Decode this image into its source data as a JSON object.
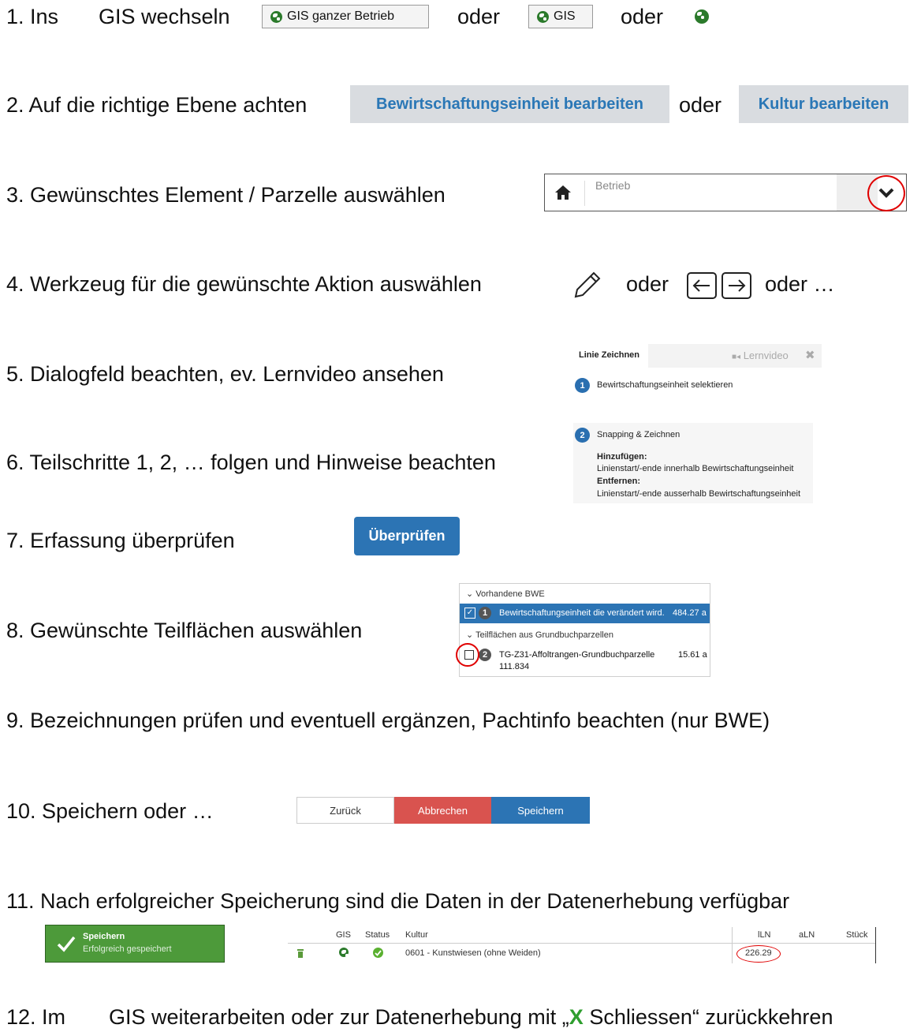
{
  "steps": {
    "s1": {
      "num": "1. Ins",
      "text": "GIS wechseln",
      "btn_full": "GIS ganzer Betrieb",
      "or1": "oder",
      "btn_gis": "GIS",
      "or2": "oder"
    },
    "s2": {
      "text": "2. Auf die richtige Ebene achten",
      "tab1": "Bewirtschaftungseinheit bearbeiten",
      "or": "oder",
      "tab2": "Kultur bearbeiten"
    },
    "s3": {
      "text": "3. Gewünschtes Element / Parzelle auswählen",
      "select_label": "Betrieb"
    },
    "s4": {
      "text": "4. Werkzeug für die gewünschte Aktion auswählen",
      "or1": "oder",
      "or2": "oder …"
    },
    "s5": {
      "text": "5. Dialogfeld beachten, ev. Lernvideo ansehen"
    },
    "s6": {
      "text": "6. Teilschritte 1, 2, … folgen und Hinweise beachten"
    },
    "s7": {
      "text": "7. Erfassung überprüfen",
      "button": "Überprüfen"
    },
    "s8": {
      "text": "8. Gewünschte Teilflächen auswählen"
    },
    "s9": {
      "text": "9. Bezeichnungen prüfen und eventuell ergänzen, Pachtinfo beachten (nur BWE)"
    },
    "s10": {
      "text": "10. Speichern oder …",
      "back": "Zurück",
      "cancel": "Abbrechen",
      "save": "Speichern"
    },
    "s11": {
      "text": "11. Nach erfolgreicher Speicherung sind die Daten in der Datenerhebung verfügbar"
    },
    "s12": {
      "num": "12. Im",
      "pre": "GIS weiterarbeiten oder zur Datenerhebung mit „",
      "x": "X",
      "post": " Schliessen“ zurückkehren"
    }
  },
  "dialog": {
    "title": "Linie Zeichnen",
    "video": "Lernvideo",
    "step1_num": "1",
    "step1_label": "Bewirtschaftungseinheit selektieren",
    "step2_num": "2",
    "step2_label": "Snapping & Zeichnen",
    "add_head": "Hinzufügen:",
    "add_text": "Linienstart/-ende innerhalb Bewirtschaftungseinheit",
    "remove_head": "Entfernen:",
    "remove_text": "Linienstart/-ende ausserhalb Bewirtschaftungseinheit"
  },
  "bwe_list": {
    "group1": "Vorhandene BWE",
    "row1_num": "1",
    "row1_label": "Bewirtschaftungseinheit die verändert wird.",
    "row1_area": "484.27 a",
    "group2": "Teilflächen aus Grundbuchparzellen",
    "row2_num": "2",
    "row2_label": "TG-Z31-Affoltrangen-Grundbuchparzelle",
    "row2_sub": "111.834",
    "row2_area": "15.61 a"
  },
  "toast": {
    "title": "Speichern",
    "message": "Erfolgreich gespeichert"
  },
  "data_table": {
    "headers": [
      "GIS",
      "Status",
      "Kultur",
      "lLN",
      "aLN",
      "Stück"
    ],
    "row": {
      "kultur": "0601 - Kunstwiesen (ohne Weiden)",
      "lln": "226.29"
    }
  },
  "colors": {
    "accent_blue": "#2c74b4",
    "danger_red": "#d9534f",
    "success_green": "#4d9a3a",
    "highlight_circle": "#e00000",
    "x_green": "#2e9e2e"
  }
}
